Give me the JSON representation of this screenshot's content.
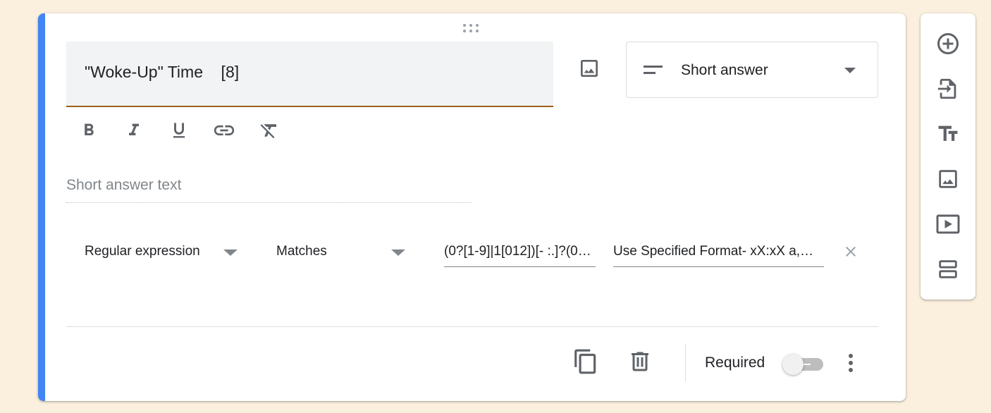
{
  "question": {
    "title": "\"Woke-Up\" Time    [8]",
    "type_label": "Short answer",
    "answer_placeholder": "Short answer text"
  },
  "format_toolbar": {
    "icons": [
      "bold-icon",
      "italic-icon",
      "underline-icon",
      "link-icon",
      "clear-formatting-icon"
    ]
  },
  "validation": {
    "type": "Regular expression",
    "condition": "Matches",
    "pattern": "(0?[1-9]|1[012])[- :.]?(0…",
    "error_text": "Use Specified Format- xX:xX a,…"
  },
  "footer": {
    "required_label": "Required",
    "required_on": false
  },
  "side_toolbar": {
    "tools": [
      "add-question-icon",
      "import-questions-icon",
      "add-title-icon",
      "add-image-icon",
      "add-video-icon",
      "add-section-icon"
    ]
  },
  "colors": {
    "background": "#fbf0dd",
    "accent": "#4285f4",
    "title_underline": "#9c5e1a",
    "icon": "#5f6368"
  }
}
